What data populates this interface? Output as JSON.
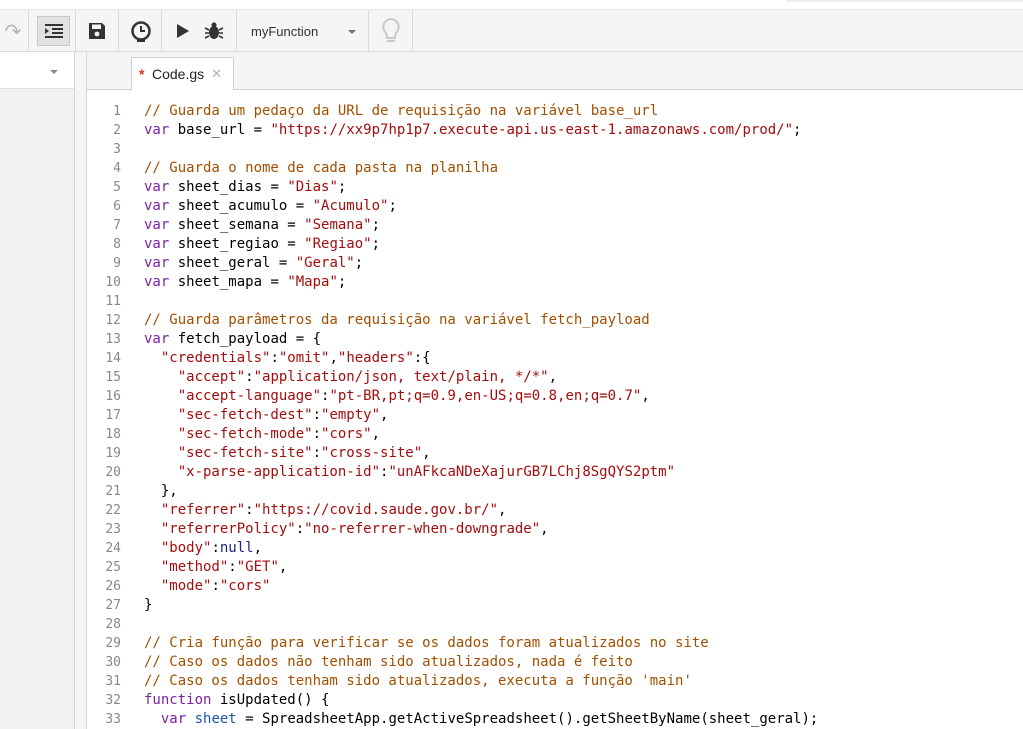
{
  "toolbar": {
    "function_select": "myFunction"
  },
  "tab": {
    "filename": "Code.gs",
    "modified_mark": "*",
    "close_glyph": "✕"
  },
  "editor": {
    "lines": [
      {
        "num": "1",
        "tokens": [
          {
            "t": "c",
            "v": "// Guarda um pedaço da URL de requisição na variável base_url"
          }
        ]
      },
      {
        "num": "2",
        "tokens": [
          {
            "t": "k",
            "v": "var"
          },
          {
            "t": "p",
            "v": " base_url = "
          },
          {
            "t": "s",
            "v": "\"https://xx9p7hp1p7.execute-api.us-east-1.amazonaws.com/prod/\""
          },
          {
            "t": "p",
            "v": ";"
          }
        ]
      },
      {
        "num": "3",
        "tokens": []
      },
      {
        "num": "4",
        "tokens": [
          {
            "t": "c",
            "v": "// Guarda o nome de cada pasta na planilha"
          }
        ]
      },
      {
        "num": "5",
        "tokens": [
          {
            "t": "k",
            "v": "var"
          },
          {
            "t": "p",
            "v": " sheet_dias = "
          },
          {
            "t": "s",
            "v": "\"Dias\""
          },
          {
            "t": "p",
            "v": ";"
          }
        ]
      },
      {
        "num": "6",
        "tokens": [
          {
            "t": "k",
            "v": "var"
          },
          {
            "t": "p",
            "v": " sheet_acumulo = "
          },
          {
            "t": "s",
            "v": "\"Acumulo\""
          },
          {
            "t": "p",
            "v": ";"
          }
        ]
      },
      {
        "num": "7",
        "tokens": [
          {
            "t": "k",
            "v": "var"
          },
          {
            "t": "p",
            "v": " sheet_semana = "
          },
          {
            "t": "s",
            "v": "\"Semana\""
          },
          {
            "t": "p",
            "v": ";"
          }
        ]
      },
      {
        "num": "8",
        "tokens": [
          {
            "t": "k",
            "v": "var"
          },
          {
            "t": "p",
            "v": " sheet_regiao = "
          },
          {
            "t": "s",
            "v": "\"Regiao\""
          },
          {
            "t": "p",
            "v": ";"
          }
        ]
      },
      {
        "num": "9",
        "tokens": [
          {
            "t": "k",
            "v": "var"
          },
          {
            "t": "p",
            "v": " sheet_geral = "
          },
          {
            "t": "s",
            "v": "\"Geral\""
          },
          {
            "t": "p",
            "v": ";"
          }
        ]
      },
      {
        "num": "10",
        "tokens": [
          {
            "t": "k",
            "v": "var"
          },
          {
            "t": "p",
            "v": " sheet_mapa = "
          },
          {
            "t": "s",
            "v": "\"Mapa\""
          },
          {
            "t": "p",
            "v": ";"
          }
        ]
      },
      {
        "num": "11",
        "tokens": []
      },
      {
        "num": "12",
        "tokens": [
          {
            "t": "c",
            "v": "// Guarda parâmetros da requisição na variável fetch_payload"
          }
        ]
      },
      {
        "num": "13",
        "tokens": [
          {
            "t": "k",
            "v": "var"
          },
          {
            "t": "p",
            "v": " fetch_payload = {"
          }
        ]
      },
      {
        "num": "14",
        "tokens": [
          {
            "t": "p",
            "v": "  "
          },
          {
            "t": "s",
            "v": "\"credentials\""
          },
          {
            "t": "p",
            "v": ":"
          },
          {
            "t": "s",
            "v": "\"omit\""
          },
          {
            "t": "p",
            "v": ","
          },
          {
            "t": "s",
            "v": "\"headers\""
          },
          {
            "t": "p",
            "v": ":{"
          }
        ]
      },
      {
        "num": "15",
        "tokens": [
          {
            "t": "p",
            "v": "    "
          },
          {
            "t": "s",
            "v": "\"accept\""
          },
          {
            "t": "p",
            "v": ":"
          },
          {
            "t": "s",
            "v": "\"application/json, text/plain, */*\""
          },
          {
            "t": "p",
            "v": ","
          }
        ]
      },
      {
        "num": "16",
        "tokens": [
          {
            "t": "p",
            "v": "    "
          },
          {
            "t": "s",
            "v": "\"accept-language\""
          },
          {
            "t": "p",
            "v": ":"
          },
          {
            "t": "s",
            "v": "\"pt-BR,pt;q=0.9,en-US;q=0.8,en;q=0.7\""
          },
          {
            "t": "p",
            "v": ","
          }
        ]
      },
      {
        "num": "17",
        "tokens": [
          {
            "t": "p",
            "v": "    "
          },
          {
            "t": "s",
            "v": "\"sec-fetch-dest\""
          },
          {
            "t": "p",
            "v": ":"
          },
          {
            "t": "s",
            "v": "\"empty\""
          },
          {
            "t": "p",
            "v": ","
          }
        ]
      },
      {
        "num": "18",
        "tokens": [
          {
            "t": "p",
            "v": "    "
          },
          {
            "t": "s",
            "v": "\"sec-fetch-mode\""
          },
          {
            "t": "p",
            "v": ":"
          },
          {
            "t": "s",
            "v": "\"cors\""
          },
          {
            "t": "p",
            "v": ","
          }
        ]
      },
      {
        "num": "19",
        "tokens": [
          {
            "t": "p",
            "v": "    "
          },
          {
            "t": "s",
            "v": "\"sec-fetch-site\""
          },
          {
            "t": "p",
            "v": ":"
          },
          {
            "t": "s",
            "v": "\"cross-site\""
          },
          {
            "t": "p",
            "v": ","
          }
        ]
      },
      {
        "num": "20",
        "tokens": [
          {
            "t": "p",
            "v": "    "
          },
          {
            "t": "s",
            "v": "\"x-parse-application-id\""
          },
          {
            "t": "p",
            "v": ":"
          },
          {
            "t": "s",
            "v": "\"unAFkcaNDeXajurGB7LChj8SgQYS2ptm\""
          }
        ]
      },
      {
        "num": "21",
        "tokens": [
          {
            "t": "p",
            "v": "  },"
          }
        ]
      },
      {
        "num": "22",
        "tokens": [
          {
            "t": "p",
            "v": "  "
          },
          {
            "t": "s",
            "v": "\"referrer\""
          },
          {
            "t": "p",
            "v": ":"
          },
          {
            "t": "s",
            "v": "\"https://covid.saude.gov.br/\""
          },
          {
            "t": "p",
            "v": ","
          }
        ]
      },
      {
        "num": "23",
        "tokens": [
          {
            "t": "p",
            "v": "  "
          },
          {
            "t": "s",
            "v": "\"referrerPolicy\""
          },
          {
            "t": "p",
            "v": ":"
          },
          {
            "t": "s",
            "v": "\"no-referrer-when-downgrade\""
          },
          {
            "t": "p",
            "v": ","
          }
        ]
      },
      {
        "num": "24",
        "tokens": [
          {
            "t": "p",
            "v": "  "
          },
          {
            "t": "s",
            "v": "\"body\""
          },
          {
            "t": "p",
            "v": ":"
          },
          {
            "t": "n",
            "v": "null"
          },
          {
            "t": "p",
            "v": ","
          }
        ]
      },
      {
        "num": "25",
        "tokens": [
          {
            "t": "p",
            "v": "  "
          },
          {
            "t": "s",
            "v": "\"method\""
          },
          {
            "t": "p",
            "v": ":"
          },
          {
            "t": "s",
            "v": "\"GET\""
          },
          {
            "t": "p",
            "v": ","
          }
        ]
      },
      {
        "num": "26",
        "tokens": [
          {
            "t": "p",
            "v": "  "
          },
          {
            "t": "s",
            "v": "\"mode\""
          },
          {
            "t": "p",
            "v": ":"
          },
          {
            "t": "s",
            "v": "\"cors\""
          }
        ]
      },
      {
        "num": "27",
        "tokens": [
          {
            "t": "p",
            "v": "}"
          }
        ]
      },
      {
        "num": "28",
        "tokens": []
      },
      {
        "num": "29",
        "tokens": [
          {
            "t": "c",
            "v": "// Cria função para verificar se os dados foram atualizados no site"
          }
        ]
      },
      {
        "num": "30",
        "tokens": [
          {
            "t": "c",
            "v": "// Caso os dados não tenham sido atualizados, nada é feito"
          }
        ]
      },
      {
        "num": "31",
        "tokens": [
          {
            "t": "c",
            "v": "// Caso os dados tenham sido atualizados, executa a função 'main'"
          }
        ]
      },
      {
        "num": "32",
        "tokens": [
          {
            "t": "k",
            "v": "function"
          },
          {
            "t": "p",
            "v": " isUpdated() {"
          }
        ]
      },
      {
        "num": "33",
        "tokens": [
          {
            "t": "p",
            "v": "  "
          },
          {
            "t": "k",
            "v": "var"
          },
          {
            "t": "p",
            "v": " "
          },
          {
            "t": "v",
            "v": "sheet"
          },
          {
            "t": "p",
            "v": " = SpreadsheetApp.getActiveSpreadsheet().getSheetByName(sheet_geral);"
          }
        ]
      }
    ]
  }
}
